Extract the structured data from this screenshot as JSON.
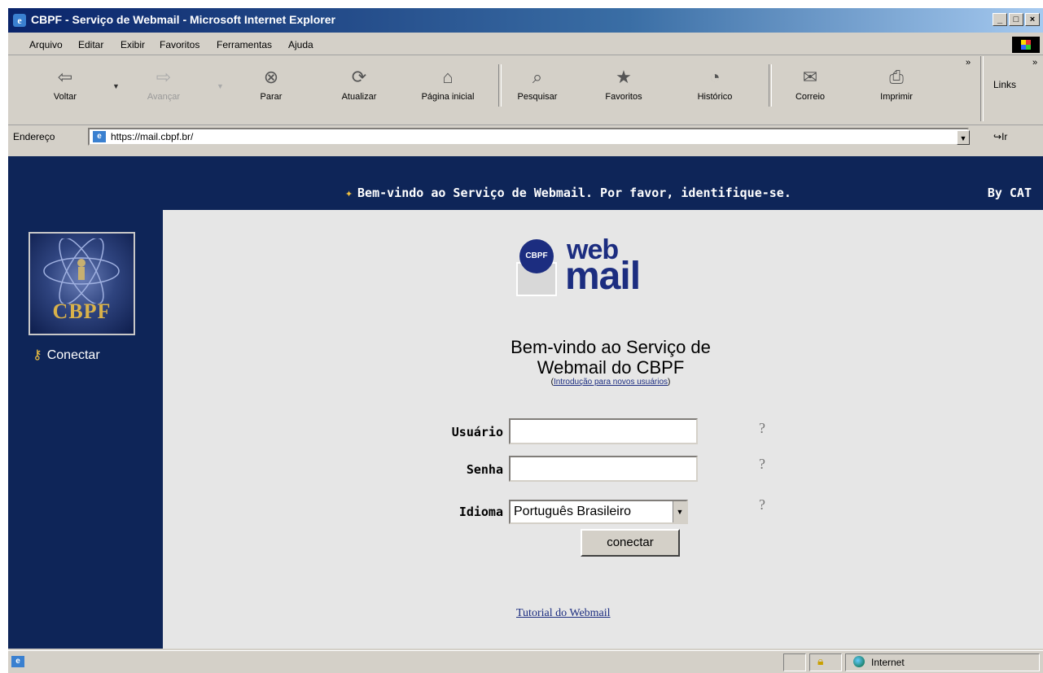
{
  "window": {
    "title": "CBPF - Serviço de Webmail - Microsoft Internet Explorer",
    "controls": [
      "_",
      "□",
      "×"
    ]
  },
  "menu": [
    "Arquivo",
    "Editar",
    "Exibir",
    "Favoritos",
    "Ferramentas",
    "Ajuda"
  ],
  "toolbar": {
    "buttons": [
      {
        "label": "Voltar",
        "icon": "back-arrow-icon",
        "enabled": true
      },
      {
        "label": "Avançar",
        "icon": "forward-arrow-icon",
        "enabled": false
      },
      {
        "label": "Parar",
        "icon": "stop-icon",
        "enabled": true
      },
      {
        "label": "Atualizar",
        "icon": "refresh-icon",
        "enabled": true
      },
      {
        "label": "Página inicial",
        "icon": "home-icon",
        "enabled": true
      },
      {
        "label": "Pesquisar",
        "icon": "search-icon",
        "enabled": true
      },
      {
        "label": "Favoritos",
        "icon": "favorites-icon",
        "enabled": true
      },
      {
        "label": "Histórico",
        "icon": "history-icon",
        "enabled": true
      },
      {
        "label": "Correio",
        "icon": "mail-icon",
        "enabled": true
      },
      {
        "label": "Imprimir",
        "icon": "print-icon",
        "enabled": true
      }
    ],
    "links_label": "Links",
    "chevron": "»"
  },
  "address": {
    "label": "Endereço",
    "url": "https://mail.cbpf.br/",
    "go_label": "Ir"
  },
  "page": {
    "welcome_banner": "Bem-vindo ao Serviço de Webmail. Por favor, identifique-se.",
    "by_cat": "By CAT",
    "sidebar": {
      "logo_text": "CBPF",
      "connect_label": "Conectar"
    },
    "logo": {
      "badge": "CBPF",
      "word1": "web",
      "word2": "mail"
    },
    "heading_line1": "Bem-vindo ao Serviço de",
    "heading_line2": "Webmail do CBPF",
    "intro_link": "Introdução para novos usuários",
    "form": {
      "user_label": "Usuário",
      "user_value": "",
      "password_label": "Senha",
      "password_value": "",
      "language_label": "Idioma",
      "language_selected": "Português Brasileiro",
      "help_glyph": "?",
      "submit_label": "conectar"
    },
    "tutorial_link": "Tutorial do Webmail"
  },
  "status": {
    "text": "",
    "zone": "Internet"
  }
}
